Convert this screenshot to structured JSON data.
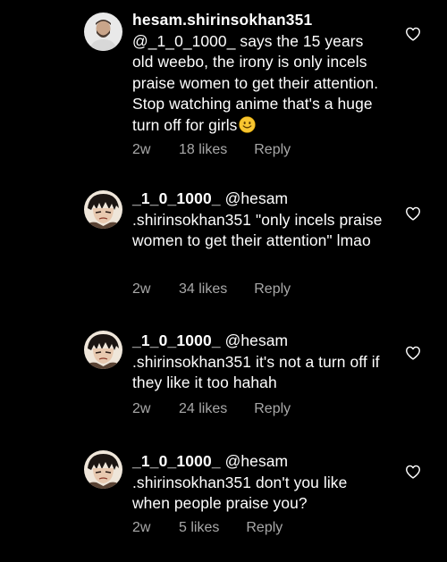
{
  "comments": [
    {
      "username": "hesam.shirinsokhan351",
      "text": "@_1_0_1000_ says the 15 years old weebo, the irony is only incels praise women to get their attention. Stop watching anime that's a huge turn off for girls",
      "emoji": "slightly-smiling-face",
      "time": "2w",
      "likes": "18 likes",
      "reply": "Reply",
      "avatar": "person-avatar-light",
      "liked": false
    },
    {
      "username": "_1_0_1000_",
      "text": "@hesam .shirinsokhan351 \"only incels praise women to get their attention\" lmao",
      "time": "2w",
      "likes": "34 likes",
      "reply": "Reply",
      "avatar": "manga-character-avatar",
      "liked": false
    },
    {
      "username": "_1_0_1000_",
      "text": "@hesam .shirinsokhan351 it's not a turn off if they like it too hahah",
      "time": "2w",
      "likes": "24 likes",
      "reply": "Reply",
      "avatar": "manga-character-avatar",
      "liked": false
    },
    {
      "username": "_1_0_1000_",
      "text": "@hesam .shirinsokhan351 don't you like when people praise you?",
      "time": "2w",
      "likes": "5 likes",
      "reply": "Reply",
      "avatar": "manga-character-avatar",
      "liked": false
    }
  ],
  "colors": {
    "background": "#000000",
    "text": "#ffffff",
    "secondary": "#a8a8a8",
    "emoji": "#f7c531"
  }
}
